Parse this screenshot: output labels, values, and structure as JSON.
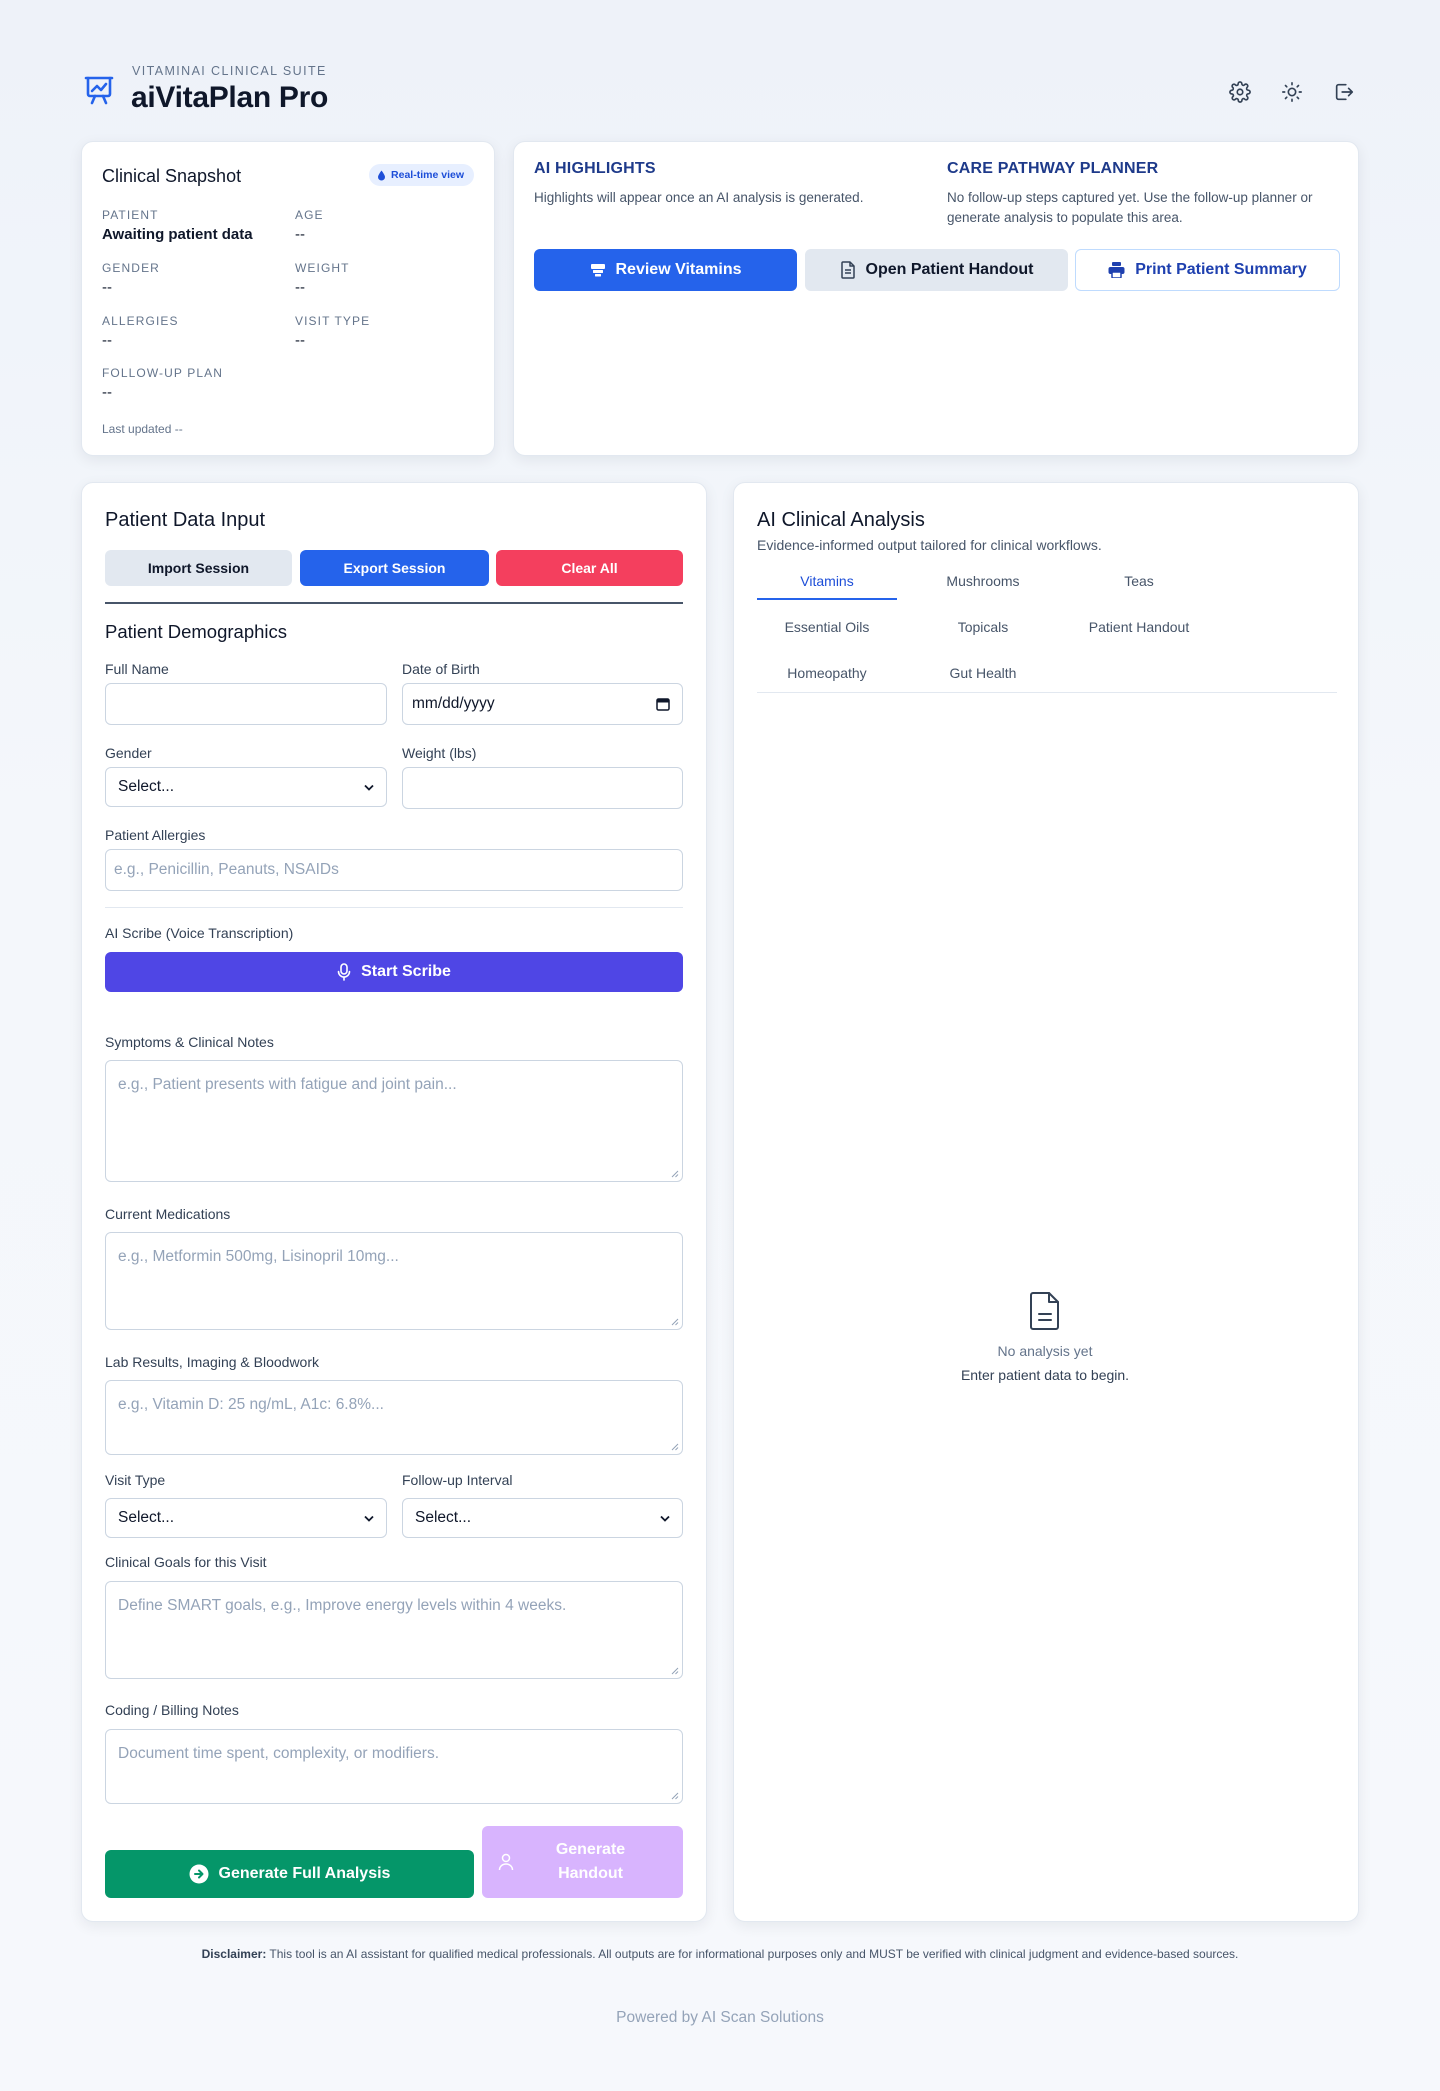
{
  "header": {
    "suite": "VITAMINAI CLINICAL SUITE",
    "app_name": "aiVitaPlan Pro",
    "icons": [
      "settings-icon",
      "sun-icon",
      "logout-icon"
    ]
  },
  "snapshot": {
    "title": "Clinical Snapshot",
    "badge": "Real-time view",
    "patient_label": "PATIENT",
    "patient_value": "Awaiting patient data",
    "age_label": "AGE",
    "age_value": "--",
    "gender_label": "GENDER",
    "gender_value": "--",
    "weight_label": "WEIGHT",
    "weight_value": "--",
    "allergies_label": "ALLERGIES",
    "allergies_value": "--",
    "visit_type_label": "VISIT TYPE",
    "visit_type_value": "--",
    "followup_label": "FOLLOW-UP PLAN",
    "followup_value": "--",
    "last_updated": "Last updated --"
  },
  "highlights": {
    "ai_title": "AI HIGHLIGHTS",
    "ai_text": "Highlights will appear once an AI analysis is generated.",
    "care_title": "CARE PATHWAY PLANNER",
    "care_text": "No follow-up steps captured yet. Use the follow-up planner or generate analysis to populate this area.",
    "review_vitamins": "Review Vitamins",
    "open_handout": "Open Patient Handout",
    "print_summary": "Print Patient Summary"
  },
  "form": {
    "title": "Patient Data Input",
    "import_session": "Import Session",
    "export_session": "Export Session",
    "clear_all": "Clear All",
    "demographics_title": "Patient Demographics",
    "full_name_label": "Full Name",
    "full_name_value": "",
    "dob_label": "Date of Birth",
    "dob_value": "mm/dd/yyyy",
    "gender_label": "Gender",
    "gender_value": "Select...",
    "weight_label": "Weight (lbs)",
    "weight_value": "",
    "allergies_label": "Patient Allergies",
    "allergies_placeholder": "e.g., Penicillin, Peanuts, NSAIDs",
    "scribe_label": "AI Scribe (Voice Transcription)",
    "start_scribe": "Start Scribe",
    "symptoms_label": "Symptoms & Clinical Notes",
    "symptoms_placeholder": "e.g., Patient presents with fatigue and joint pain...",
    "meds_label": "Current Medications",
    "meds_placeholder": "e.g., Metformin 500mg, Lisinopril 10mg...",
    "labs_label": "Lab Results, Imaging & Bloodwork",
    "labs_placeholder": "e.g., Vitamin D: 25 ng/mL, A1c: 6.8%...",
    "visit_type_label": "Visit Type",
    "visit_type_value": "Select...",
    "followup_label": "Follow-up Interval",
    "followup_value": "Select...",
    "goals_label": "Clinical Goals for this Visit",
    "goals_placeholder": "Define SMART goals, e.g., Improve energy levels within 4 weeks.",
    "billing_label": "Coding / Billing Notes",
    "billing_placeholder": "Document time spent, complexity, or modifiers.",
    "generate_analysis": "Generate Full Analysis",
    "generate_handout_1": "Generate",
    "generate_handout_2": "Handout"
  },
  "analysis": {
    "title": "AI Clinical Analysis",
    "subtitle": "Evidence-informed output tailored for clinical workflows.",
    "tabs": [
      "Vitamins",
      "Mushrooms",
      "Teas",
      "Essential Oils",
      "Topicals",
      "Patient Handout",
      "Homeopathy",
      "Gut Health"
    ],
    "active_tab": "Vitamins",
    "empty_title": "No analysis yet",
    "empty_text": "Enter patient data to begin."
  },
  "footer": {
    "disclaimer_label": "Disclaimer:",
    "disclaimer_text": " This tool is an AI assistant for qualified medical professionals. All outputs are for informational purposes only and MUST be verified with clinical judgment and evidence-based sources.",
    "powered_by": "Powered by AI Scan Solutions"
  },
  "colors": {
    "primary": "#2563eb",
    "indigo": "#4f46e5",
    "danger": "#f43f5e",
    "success": "#059669",
    "lavender": "#d8b4fe",
    "heading_blue": "#1e3a8a"
  }
}
